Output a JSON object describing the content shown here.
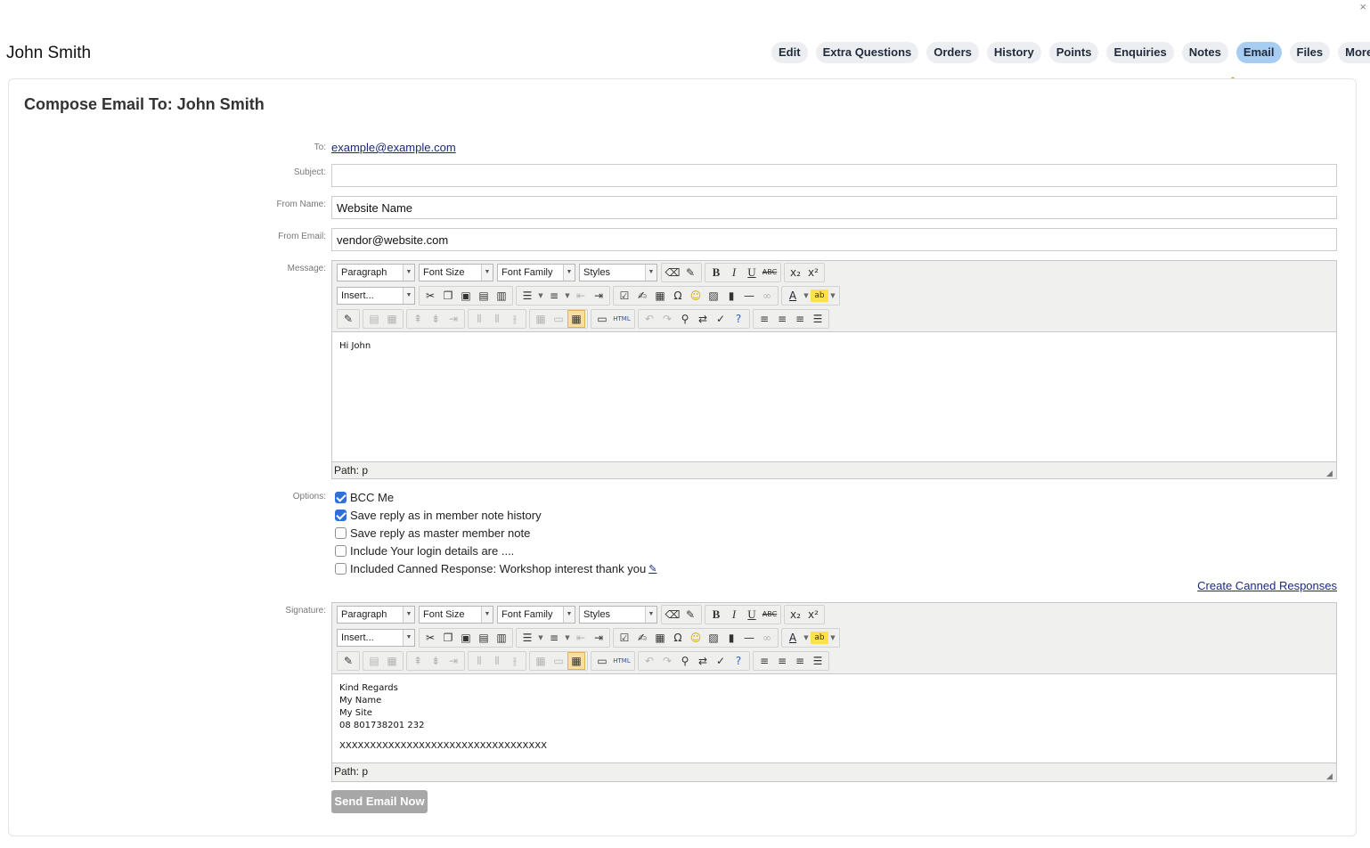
{
  "header": {
    "member_name": "John Smith",
    "close_icon": "×"
  },
  "tabs": [
    {
      "label": "Edit",
      "active": false
    },
    {
      "label": "Extra Questions",
      "active": false
    },
    {
      "label": "Orders",
      "active": false
    },
    {
      "label": "History",
      "active": false
    },
    {
      "label": "Points",
      "active": false
    },
    {
      "label": "Enquiries",
      "active": false
    },
    {
      "label": "Notes",
      "active": false
    },
    {
      "label": "Email",
      "active": true
    },
    {
      "label": "Files",
      "active": false
    },
    {
      "label": "More...",
      "active": false
    }
  ],
  "compose": {
    "heading": "Compose Email To: John Smith",
    "to_label": "To:",
    "to_value": "example@example.com",
    "subject_label": "Subject:",
    "subject_value": "",
    "from_name_label": "From Name:",
    "from_name_value": "Website Name",
    "from_email_label": "From Email:",
    "from_email_value": "vendor@website.com",
    "message_label": "Message:",
    "options_label": "Options:",
    "signature_label": "Signature:"
  },
  "editor_toolbar": {
    "paragraph": "Paragraph",
    "font_size": "Font Size",
    "font_family": "Font Family",
    "styles": "Styles",
    "insert": "Insert...",
    "html_label": "HTML"
  },
  "message_editor": {
    "lines": [
      "Hi John"
    ],
    "path": "Path: p"
  },
  "signature_editor": {
    "lines": [
      "Kind Regards",
      "My Name",
      "My Site",
      "08 801738201 232"
    ],
    "extra_line": "XXXXXXXXXXXXXXXXXXXXXXXXXXXXXXXXXX",
    "path": "Path: p"
  },
  "options": [
    {
      "label": "BCC Me",
      "checked": true
    },
    {
      "label": "Save reply as in member note history",
      "checked": true
    },
    {
      "label": "Save reply as master member note",
      "checked": false
    },
    {
      "label": "Include Your login details are ....",
      "checked": false
    },
    {
      "label": "Included Canned Response: Workshop interest thank you",
      "checked": false
    }
  ],
  "canned_link": "Create Canned Responses",
  "send_button": "Send Email Now",
  "colors": {
    "active_tab": "#a8cdf2",
    "annotation_arrow": "#f7941d",
    "link": "#1a2b7a",
    "send_button": "#a7a7a7"
  }
}
